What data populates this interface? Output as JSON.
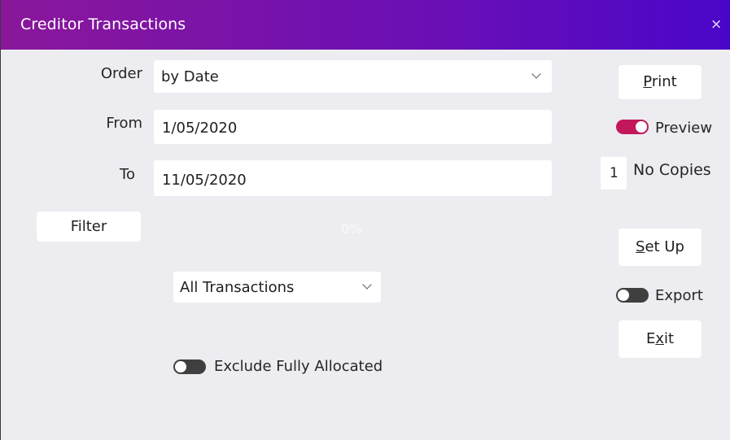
{
  "window": {
    "title": "Creditor Transactions",
    "close_glyph": "×"
  },
  "order": {
    "label": "Order",
    "value": "by Date"
  },
  "from": {
    "label": "From",
    "value": "1/05/2020"
  },
  "to": {
    "label": "To",
    "value": "11/05/2020"
  },
  "filter": {
    "label": "Filter"
  },
  "progress": {
    "text": "0%",
    "value_percent": 0
  },
  "transactions": {
    "value": "All Transactions"
  },
  "exclude": {
    "label": "Exclude Fully Allocated",
    "on": false
  },
  "print": {
    "pre": "",
    "u": "P",
    "post": "rint"
  },
  "preview": {
    "label": "Preview",
    "on": true
  },
  "copies": {
    "value": "1",
    "label": "No Copies"
  },
  "setup": {
    "pre": "",
    "u": "S",
    "post": "et Up"
  },
  "export": {
    "label": "Export",
    "on": false
  },
  "exit": {
    "pre": "E",
    "u": "x",
    "post": "it"
  },
  "colors": {
    "title_start": "#8a179a",
    "title_end": "#4a06c8",
    "toggle_on": "#c2185b",
    "toggle_off": "#3f3f3f"
  }
}
